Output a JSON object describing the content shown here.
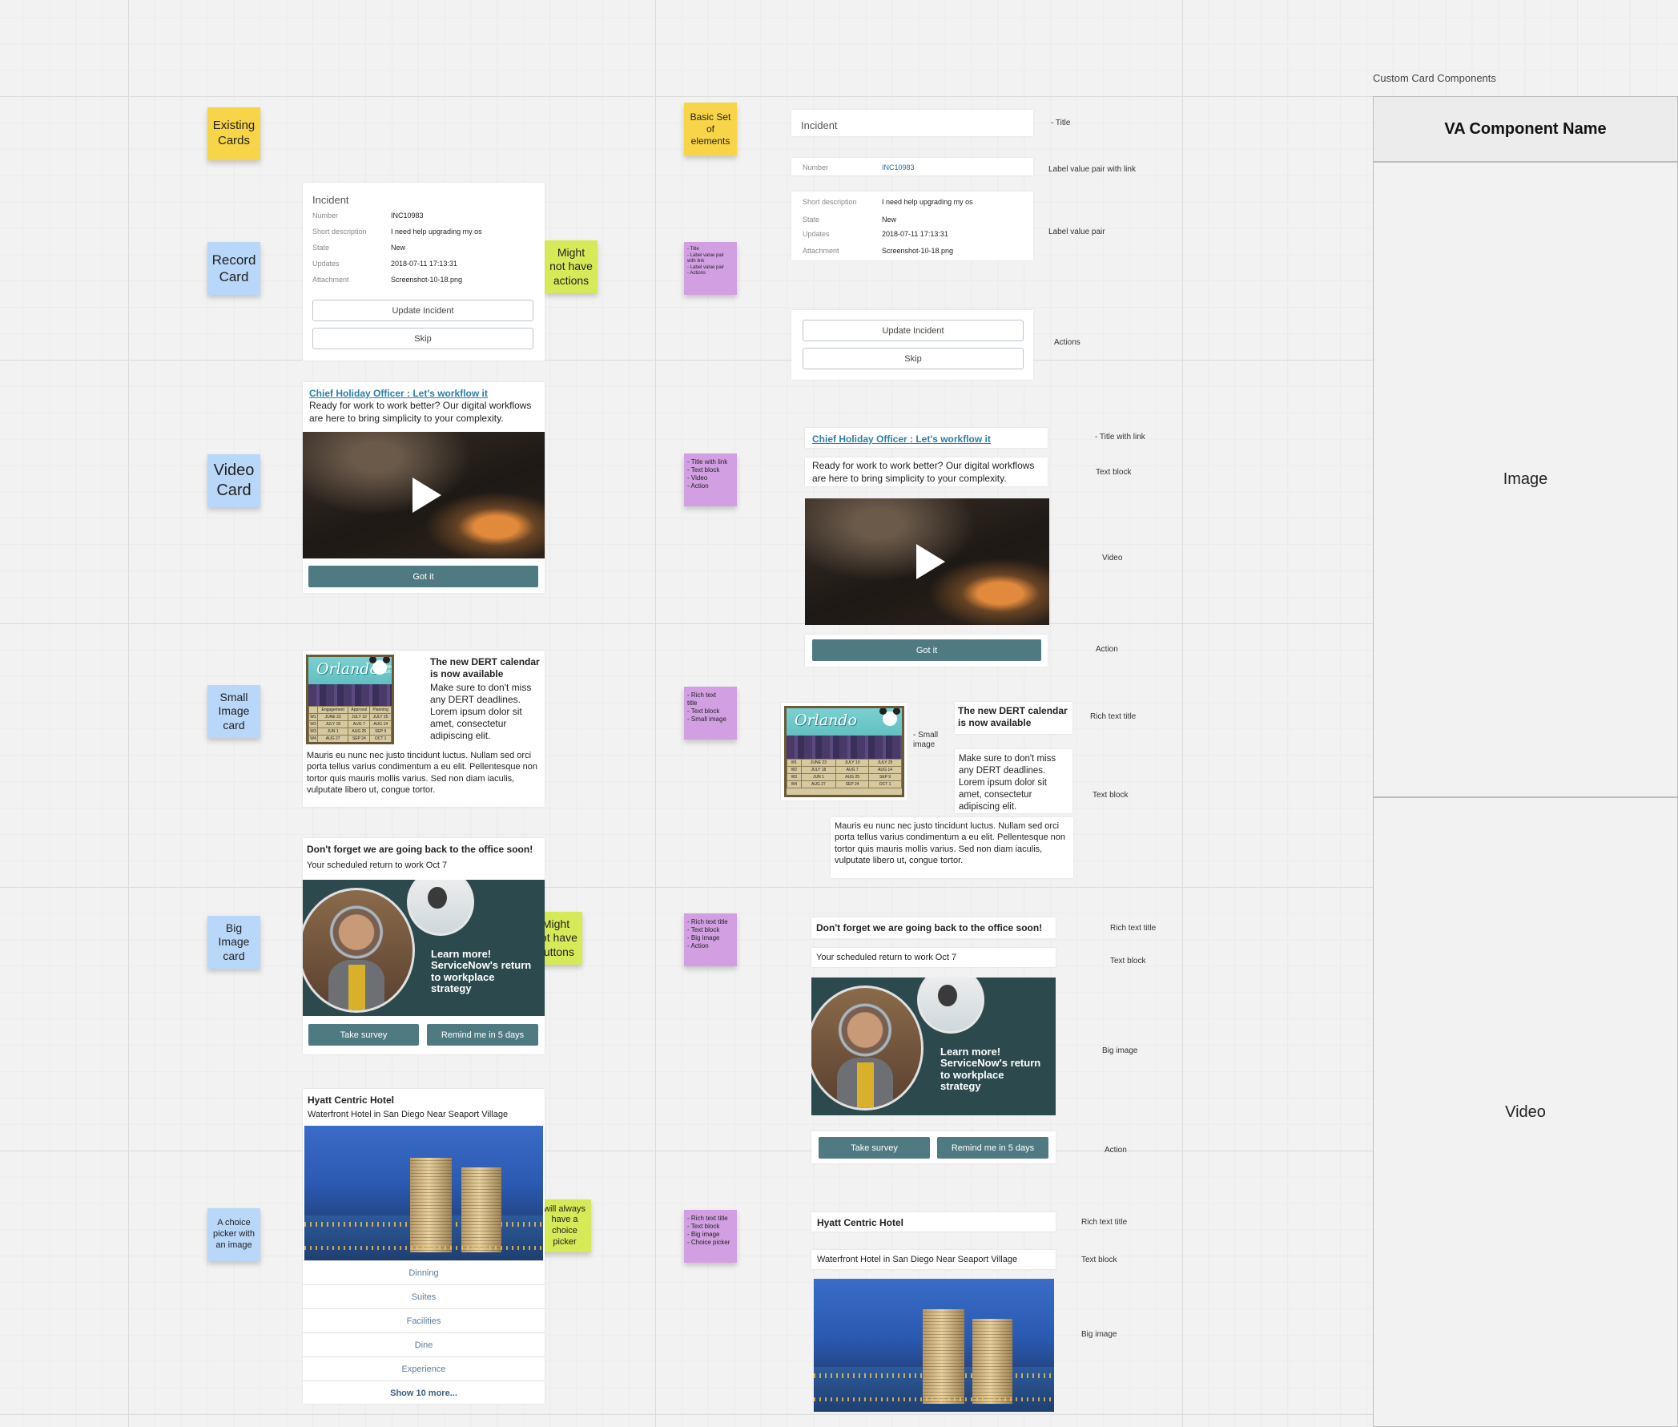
{
  "board": {
    "section_label": "Custom Card Components"
  },
  "stickies": {
    "existing_cards": "Existing\nCards",
    "record_card": "Record\nCard",
    "video_card": "Video\nCard",
    "small_image_card": "Small\nImage\ncard",
    "big_image_card": "Big\nImage\ncard",
    "choice_picker": "A choice\npicker with\nan image",
    "might_not_actions": "Might\nnot have\nactions",
    "might_not_buttons": "Might\nnot have\nbuttons",
    "always_choice": "will always\nhave a\nchoice\npicker",
    "basic_set": "Basic Set\nof\nelements",
    "p_record": "- Title\n- Label value pair\nwith link\n- Label value pair\n- Actions",
    "p_video": "- Title with link\n- Text block\n- Video\n- Action",
    "p_small": "- Rich text\ntitle\n- Text block\n- Small image",
    "p_big": "- Rich text title\n- Text block\n- Big image\n- Action",
    "p_choice": "- Rich text title\n- Text block\n- Big image\n- Choice picker"
  },
  "record_card": {
    "title": "Incident",
    "rows": [
      {
        "key": "Number",
        "value": "INC10983"
      },
      {
        "key": "Short description",
        "value": "I need help upgrading my os"
      },
      {
        "key": "State",
        "value": "New"
      },
      {
        "key": "Updates",
        "value": "2018-07-11 17:13:31"
      },
      {
        "key": "Attachment",
        "value": "Screenshot-10-18.png"
      }
    ],
    "primary_action": "Update Incident",
    "secondary_action": "Skip"
  },
  "video_card": {
    "title_link": "Chief Holiday Officer : Let's workflow it",
    "text": "Ready for work to work better? Our digital workflows are here to bring simplicity to your complexity.",
    "action": "Got it"
  },
  "small_image_card": {
    "image_title": "Orlando",
    "image_subtitle": "PLANNING WEEKS",
    "image_grid": [
      [
        "",
        "Engagement",
        "Approval",
        "Planning"
      ],
      [
        "W1",
        "JUNE 23",
        "JULY 10",
        "JULY 25"
      ],
      [
        "W2",
        "JULY 18",
        "AUG 7",
        "AUG 14"
      ],
      [
        "W3",
        "JUN 1",
        "AUG 25",
        "SEP 9"
      ],
      [
        "W4",
        "AUG 27",
        "SEP 24",
        "OCT 1"
      ]
    ],
    "title": "The new DERT calendar is now available",
    "side_text": "Make sure to don't miss any DERT deadlines. Lorem ipsum dolor sit amet, consectetur adipiscing elit.",
    "body_text": "Mauris eu nunc nec justo tincidunt luctus. Nullam sed orci porta tellus varius condimentum a eu elit. Pellentesque non tortor quis mauris mollis varius. Sed non diam iaculis, vulputate libero ut, congue tortor."
  },
  "big_image_card": {
    "title": "Don't forget we are going back to the office soon!",
    "subtitle": "Your scheduled return to work Oct 7",
    "promo_text": "Learn more!\nServiceNow's return\nto workplace\nstrategy",
    "actions": [
      "Take survey",
      "Remind me in 5 days"
    ]
  },
  "choice_card": {
    "title": "Hyatt Centric Hotel",
    "subtitle": "Waterfront Hotel in San Diego Near Seaport Village",
    "choices": [
      "Dinning",
      "Suites",
      "Facilities",
      "Dine",
      "Experience"
    ],
    "more": "Show 10 more..."
  },
  "annotations": {
    "title": "- Title",
    "label_value_link": "Label value pair with link",
    "label_value": "Label value pair",
    "actions": "Actions",
    "title_with_link": "- Title with link",
    "text_block": "Text block",
    "video": "Video",
    "action": "Action",
    "rich_text_title": "Rich text title",
    "small_image": "- Small\nimage",
    "big_image": "Big image"
  },
  "panel": {
    "header": "VA Component Name",
    "cells": [
      "Image",
      "Video"
    ]
  },
  "colors": {
    "sticky_yellow": "#f8d548",
    "sticky_blue": "#b9d7f8",
    "sticky_green": "#d6ea57",
    "sticky_purple": "#d39fe3",
    "action_teal": "#4f7a82",
    "link_blue": "#2a6fb0"
  }
}
